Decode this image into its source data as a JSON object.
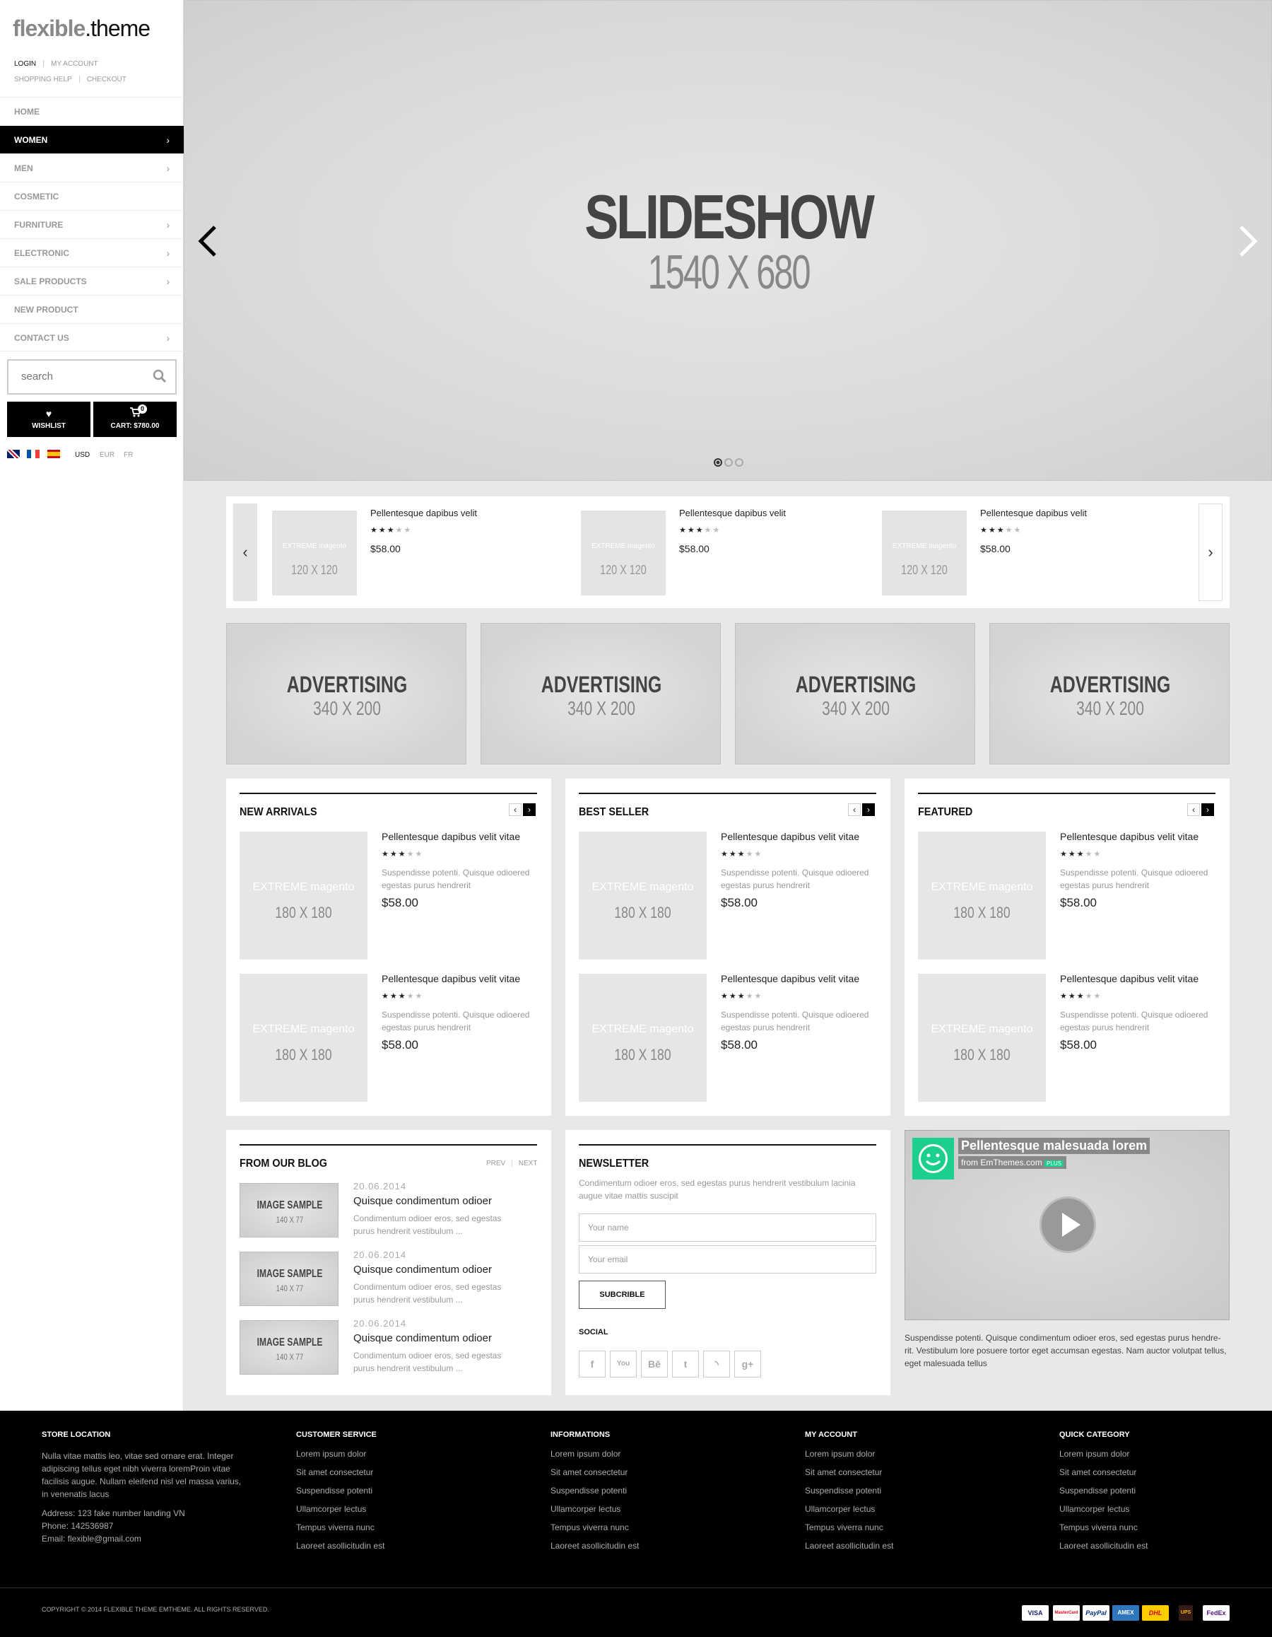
{
  "logo": {
    "part1": "flexible",
    "part2": ".theme"
  },
  "toplinks": {
    "login": "LOGIN",
    "account": "MY ACCOUNT",
    "help": "SHOPPING HELP",
    "checkout": "CHECKOUT"
  },
  "nav": [
    {
      "label": "HOME"
    },
    {
      "label": "WOMEN"
    },
    {
      "label": "MEN"
    },
    {
      "label": "COSMETIC"
    },
    {
      "label": "FURNITURE"
    },
    {
      "label": "ELECTRONIC"
    },
    {
      "label": "SALE PRODUCTS"
    },
    {
      "label": "NEW PRODUCT"
    },
    {
      "label": "CONTACT US"
    }
  ],
  "search": {
    "placeholder": "search"
  },
  "wishlist": {
    "label": "WISHLIST"
  },
  "cart": {
    "label": "CART: $780.00",
    "count": "0"
  },
  "currencies": {
    "usd": "USD",
    "eur": "EUR",
    "fr": "FR"
  },
  "slideshow": {
    "title": "SLIDESHOW",
    "size": "1540 X 680"
  },
  "strip": {
    "brand": "EXTREME magento",
    "size": "120 X 120",
    "items": [
      {
        "name": "Pellentesque dapibus velit",
        "price": "$58.00"
      },
      {
        "name": "Pellentesque dapibus velit",
        "price": "$58.00"
      },
      {
        "name": "Pellentesque dapibus velit",
        "price": "$58.00"
      }
    ]
  },
  "ads": {
    "title": "ADVERTISING",
    "size": "340 X 200"
  },
  "products": {
    "brand": "EXTREME magento",
    "size": "180 X 180",
    "name": "Pellentesque dapibus velit vitae",
    "desc": "Suspendisse potenti. Quisque odioered egestas purus hendrerit",
    "price": "$58.00",
    "new_arrivals": "NEW ARRIVALS",
    "best_seller": "BEST SELLER",
    "featured": "FEATURED"
  },
  "blog": {
    "title": "FROM OUR BLOG",
    "prev": "PREV",
    "next": "NEXT",
    "img_title": "IMAGE SAMPLE",
    "img_size": "140 X 77",
    "date": "20.06.2014",
    "post_title": "Quisque condimentum odioer",
    "post_text": "Condimentum odioer eros, sed egestas purus hendrerit vestibulum ..."
  },
  "newsletter": {
    "title": "NEWSLETTER",
    "text": "Condimentum odioer eros, sed egestas purus hendrerit vestibulum lacinia augue vitae mattis suscipit",
    "name_placeholder": "Your name",
    "email_placeholder": "Your email",
    "button": "SUBCRIBLE",
    "social": "SOCIAL"
  },
  "video": {
    "title": "Pellentesque malesuada lorem",
    "from": "from EmThemes.com",
    "badge": "PLUS",
    "caption": "Suspendisse potenti. Quisque condimentum odioer eros, sed egestas purus hendre-rit. Vestibulum lore posuere tortor eget accumsan egestas. Nam auctor volutpat tellus, eget malesuada tellus"
  },
  "footer": {
    "store": {
      "title": "STORE LOCATION",
      "text": "Nulla vitae mattis leo, vitae sed ornare erat. Integer adipiscing tellus eget nibh viverra loremProin vitae facilisis augue. Nullam eleifend nisl vel massa varius, in venenatis lacus",
      "address": "Address: 123 fake number landing VN",
      "phone": "Phone: 142536987",
      "email": "Email: flexible@gmail.com"
    },
    "columns": [
      {
        "title": "CUSTOMER SERVICE"
      },
      {
        "title": "INFORMATIONS"
      },
      {
        "title": "MY ACCOUNT"
      },
      {
        "title": "QUICK CATEGORY"
      }
    ],
    "links": [
      "Lorem ipsum dolor",
      "Sit amet consectetur",
      "Suspendisse potenti",
      "Ullamcorper lectus",
      "Tempus viverra nunc",
      "Laoreet asollicitudin est"
    ],
    "copyright": "COPYRIGHT © 2014 FLEXIBLE THEME EMTHEME. ALL RIGHTS RESERVED.",
    "payments": [
      "VISA",
      "MasterCard",
      "PayPal",
      "AMEX",
      "DHL",
      "UPS",
      "FedEx"
    ]
  },
  "colors": {
    "accent": "#000000",
    "video_logo": "#1dcf8f",
    "dhl": "#ffcc00"
  }
}
